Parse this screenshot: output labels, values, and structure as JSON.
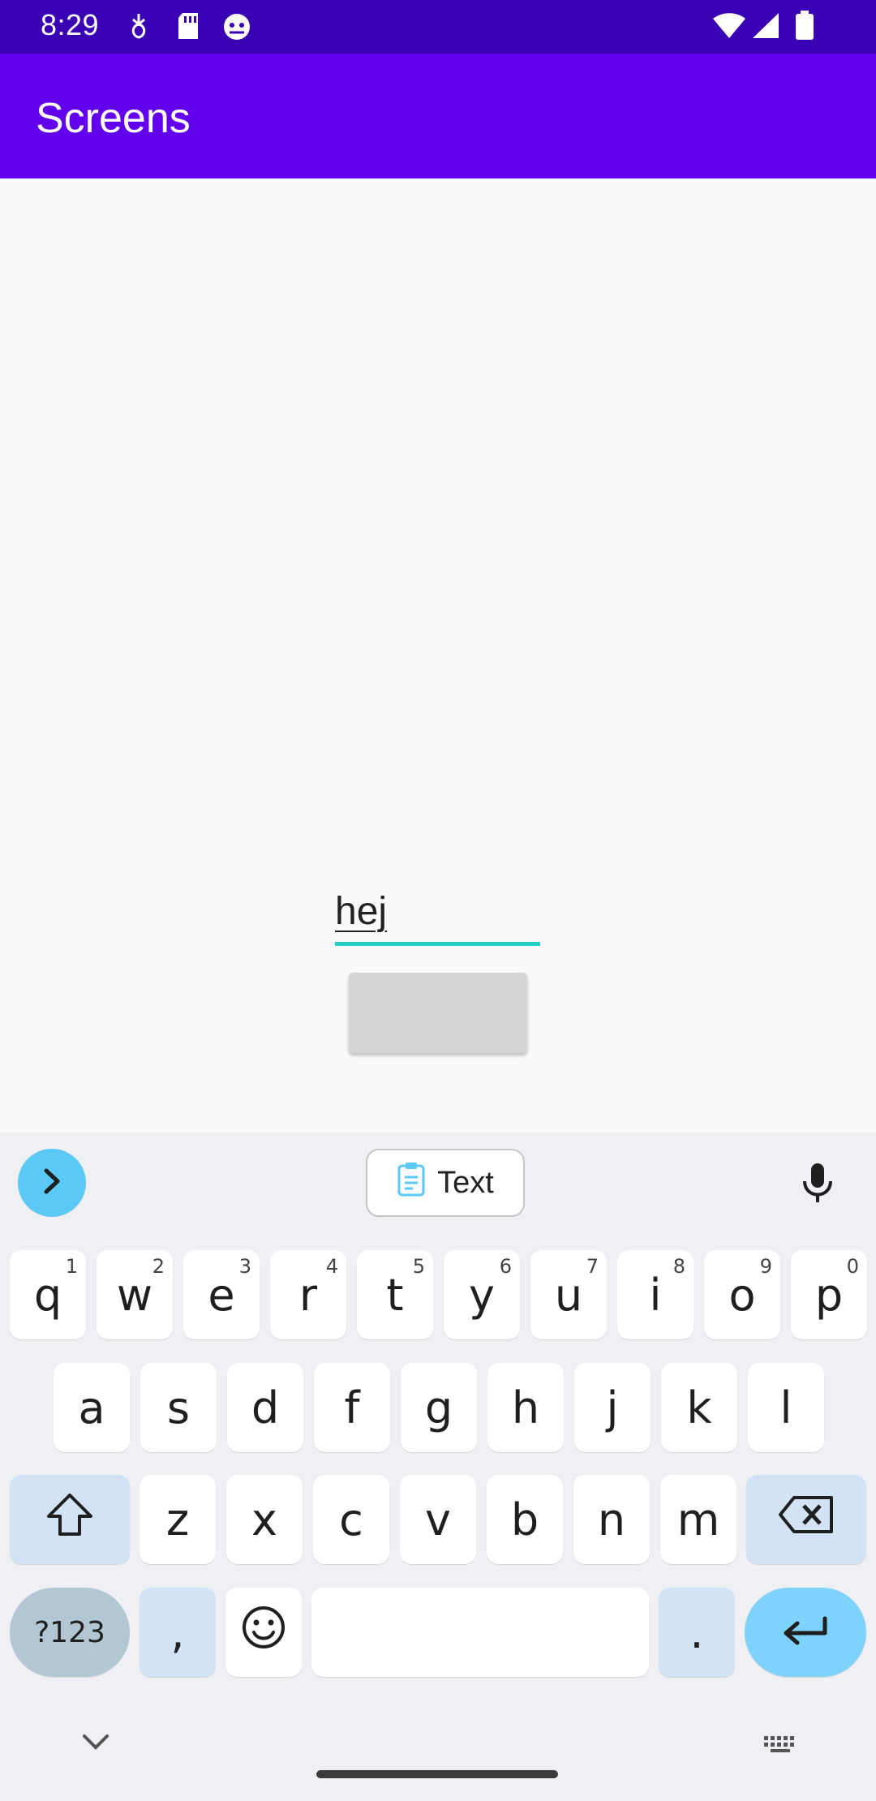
{
  "status_bar": {
    "time": "8:29",
    "left_icons": [
      "usb-debug-icon",
      "sd-card-icon",
      "android-bug-icon"
    ],
    "right_icons": [
      "wifi-icon",
      "signal-icon",
      "battery-icon"
    ],
    "bg_color": "#3a00b4"
  },
  "app_bar": {
    "title": "Screens",
    "bg_color": "#6200ee"
  },
  "content": {
    "text_field_value": "hej",
    "button_label": "",
    "accent_color": "#1ecfc4"
  },
  "keyboard": {
    "toolbar": {
      "expand_icon": "chevron-right-icon",
      "clipboard_label": "Text",
      "clipboard_icon": "clipboard-icon",
      "mic_icon": "mic-icon"
    },
    "row1": [
      {
        "label": "q",
        "hint": "1"
      },
      {
        "label": "w",
        "hint": "2"
      },
      {
        "label": "e",
        "hint": "3"
      },
      {
        "label": "r",
        "hint": "4"
      },
      {
        "label": "t",
        "hint": "5"
      },
      {
        "label": "y",
        "hint": "6"
      },
      {
        "label": "u",
        "hint": "7"
      },
      {
        "label": "i",
        "hint": "8"
      },
      {
        "label": "o",
        "hint": "9"
      },
      {
        "label": "p",
        "hint": "0"
      }
    ],
    "row2": [
      "a",
      "s",
      "d",
      "f",
      "g",
      "h",
      "j",
      "k",
      "l"
    ],
    "row3": [
      "z",
      "x",
      "c",
      "v",
      "b",
      "n",
      "m"
    ],
    "row4": {
      "symbols_label": "?123",
      "comma_label": ",",
      "period_label": ".",
      "space_label": ""
    },
    "bottom": {
      "hide_icon": "chevron-down-icon",
      "switch_icon": "keyboard-icon"
    }
  }
}
